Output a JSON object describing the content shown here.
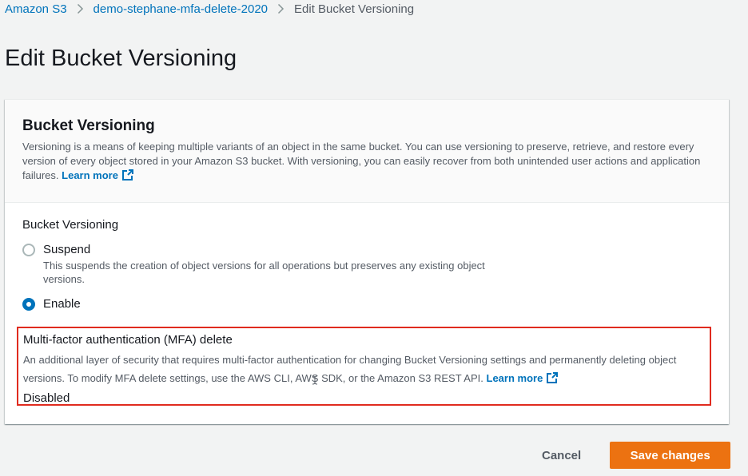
{
  "breadcrumb": {
    "items": [
      "Amazon S3",
      "demo-stephane-mfa-delete-2020"
    ],
    "current": "Edit Bucket Versioning"
  },
  "page": {
    "title": "Edit Bucket Versioning"
  },
  "panel": {
    "title": "Bucket Versioning",
    "description": "Versioning is a means of keeping multiple variants of an object in the same bucket. You can use versioning to preserve, retrieve, and restore every version of every object stored in your Amazon S3 bucket. With versioning, you can easily recover from both unintended user actions and application failures.",
    "learn_more": "Learn more"
  },
  "versioning": {
    "label": "Bucket Versioning",
    "options": [
      {
        "label": "Suspend",
        "description": "This suspends the creation of object versions for all operations but preserves any existing object versions.",
        "selected": false
      },
      {
        "label": "Enable",
        "description": "",
        "selected": true
      }
    ]
  },
  "mfa": {
    "title": "Multi-factor authentication (MFA) delete",
    "description": "An additional layer of security that requires multi-factor authentication for changing Bucket Versioning settings and permanently deleting object versions. To modify MFA delete settings, use the AWS CLI, AWS SDK, or the Amazon S3 REST API.",
    "learn_more": "Learn more",
    "status": "Disabled",
    "highlight_color": "#e02b1f"
  },
  "actions": {
    "cancel": "Cancel",
    "save": "Save changes"
  },
  "colors": {
    "link": "#0073bb",
    "primary_button": "#ec7211",
    "background": "#f2f3f3"
  },
  "icons": {
    "breadcrumb_separator": "chevron-right-icon",
    "external_link": "external-link-icon",
    "cursor": "text-cursor-icon"
  }
}
